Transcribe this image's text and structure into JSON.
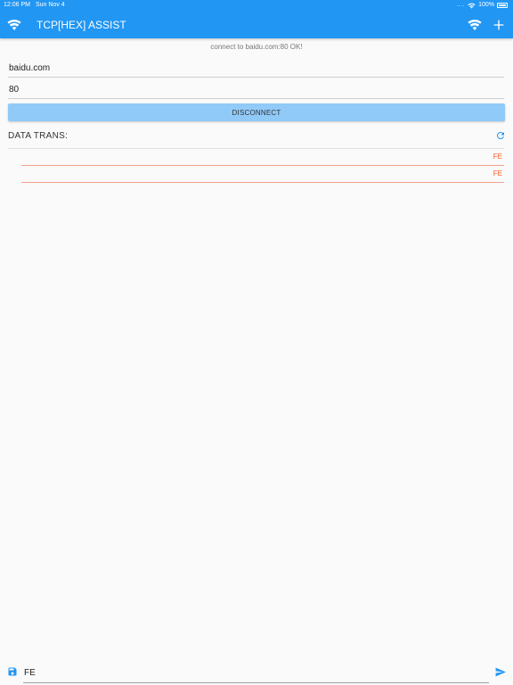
{
  "status_bar": {
    "time": "12:06 PM",
    "date": "Sun Nov 4",
    "battery": "100%",
    "signal_dots": "....",
    "icons": [
      "wifi-icon",
      "battery-icon"
    ]
  },
  "app_bar": {
    "title": "TCP[HEX] ASSIST",
    "icons": [
      "wifi-icon",
      "wifi-icon",
      "plus-icon"
    ],
    "color": "#2196f3"
  },
  "connection": {
    "status_message": "connect to baidu.com:80 OK!",
    "host_value": "baidu.com",
    "port_value": "80",
    "disconnect_label": "DISCONNECT",
    "button_color": "#90caf9"
  },
  "data_section": {
    "title": "DATA TRANS:",
    "refresh_icon": "refresh-icon",
    "rows": [
      {
        "value": "FE"
      },
      {
        "value": "FE"
      }
    ],
    "value_color": "#ff5722"
  },
  "send_bar": {
    "input_value": "FE",
    "save_icon": "save-icon",
    "send_icon": "send-icon"
  }
}
